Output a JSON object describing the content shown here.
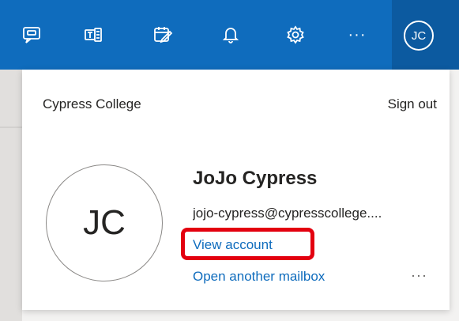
{
  "header": {
    "icons": [
      "feedback-icon",
      "teams-icon",
      "my-day-icon",
      "notifications-icon",
      "settings-icon",
      "more-icon"
    ],
    "more_label": "···",
    "avatar_initials": "JC"
  },
  "account_panel": {
    "org_name": "Cypress College",
    "sign_out_label": "Sign out",
    "avatar_initials": "JC",
    "user_name": "JoJo Cypress",
    "user_email": "jojo-cypress@cypresscollege....",
    "view_account_label": "View account",
    "open_mailbox_label": "Open another mailbox",
    "more_label": "···"
  },
  "colors": {
    "header_bg": "#0f6cbd",
    "link": "#0f6cbd",
    "highlight": "#e3000f"
  }
}
